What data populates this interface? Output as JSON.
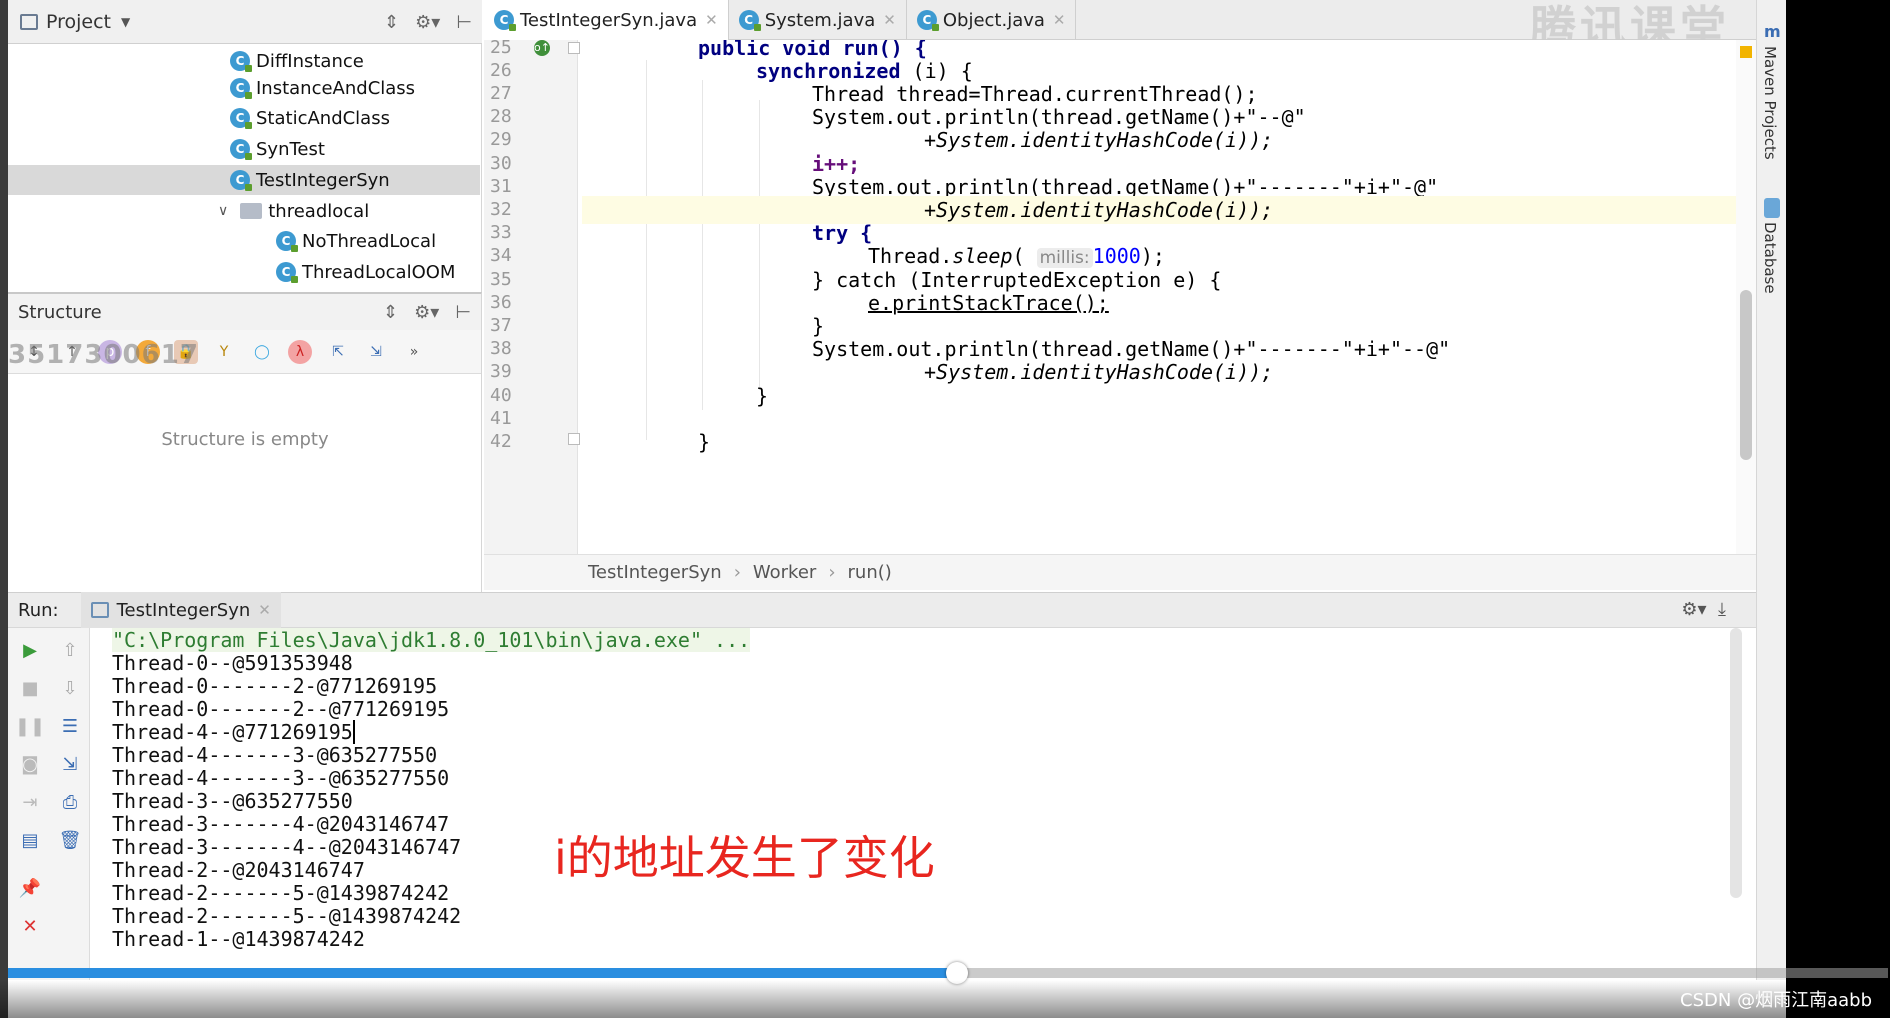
{
  "project": {
    "title": "Project",
    "items": [
      {
        "label": "DiffInstance",
        "type": "class"
      },
      {
        "label": "InstanceAndClass",
        "type": "class"
      },
      {
        "label": "StaticAndClass",
        "type": "class"
      },
      {
        "label": "SynTest",
        "type": "class"
      },
      {
        "label": "TestIntegerSyn",
        "type": "class",
        "selected": true
      },
      {
        "label": "threadlocal",
        "type": "package"
      },
      {
        "label": "NoThreadLocal",
        "type": "class"
      },
      {
        "label": "ThreadLocalOOM",
        "type": "class"
      }
    ]
  },
  "structure": {
    "title": "Structure",
    "empty_text": "Structure is empty",
    "watermark_id": "3517300617"
  },
  "editor": {
    "tabs": [
      {
        "label": "TestIntegerSyn.java",
        "active": true
      },
      {
        "label": "System.java",
        "active": false
      },
      {
        "label": "Object.java",
        "active": false
      }
    ],
    "tab_watermark": "腾讯课堂",
    "line_numbers": [
      "25",
      "26",
      "27",
      "28",
      "29",
      "30",
      "31",
      "32",
      "33",
      "34",
      "35",
      "36",
      "37",
      "38",
      "39",
      "40",
      "41",
      "42"
    ],
    "code": {
      "l25": "public void run() {",
      "l26_kw": "synchronized",
      "l26_rest": " (i) {",
      "l27": "Thread thread=Thread.currentThread();",
      "l28": "System.out.println(thread.getName()+\"--@\"",
      "l29": "+System.identityHashCode(i));",
      "l30": "i++;",
      "l31": "System.out.println(thread.getName()+\"-------\"+i+\"-@\"",
      "l32": "+System.identityHashCode(i));",
      "l33": "try {",
      "l34_hint": "millis:",
      "l34_value": "1000",
      "l35": "} catch (InterruptedException e) {",
      "l36": "e.printStackTrace();",
      "l37": "}",
      "l38": "System.out.println(thread.getName()+\"-------\"+i+\"--@\"",
      "l39": "+System.identityHashCode(i));",
      "l40": "}",
      "l42": "}"
    },
    "breadcrumb": [
      "TestIntegerSyn",
      "Worker",
      "run()"
    ]
  },
  "side_rail": {
    "maven": "Maven Projects",
    "database": "Database"
  },
  "run": {
    "label": "Run:",
    "tab": "TestIntegerSyn",
    "output": [
      "\"C:\\Program Files\\Java\\jdk1.8.0_101\\bin\\java.exe\" ...",
      "Thread-0--@591353948",
      "Thread-0-------2-@771269195",
      "Thread-0-------2--@771269195",
      "Thread-4--@771269195",
      "Thread-4-------3-@635277550",
      "Thread-4-------3--@635277550",
      "Thread-3--@635277550",
      "Thread-3-------4-@2043146747",
      "Thread-3-------4--@2043146747",
      "Thread-2--@2043146747",
      "Thread-2-------5-@1439874242",
      "Thread-2-------5--@1439874242",
      "Thread-1--@1439874242"
    ],
    "annotation": "i的地址发生了变化"
  },
  "video": {
    "progress": 0.505,
    "watermark": "CSDN @烟雨江南aabb"
  },
  "colors": {
    "keyword": "#000080",
    "string": "#008000",
    "field": "#660e7a",
    "annotation": "#e8261f",
    "progress": "#2a8ee0"
  }
}
